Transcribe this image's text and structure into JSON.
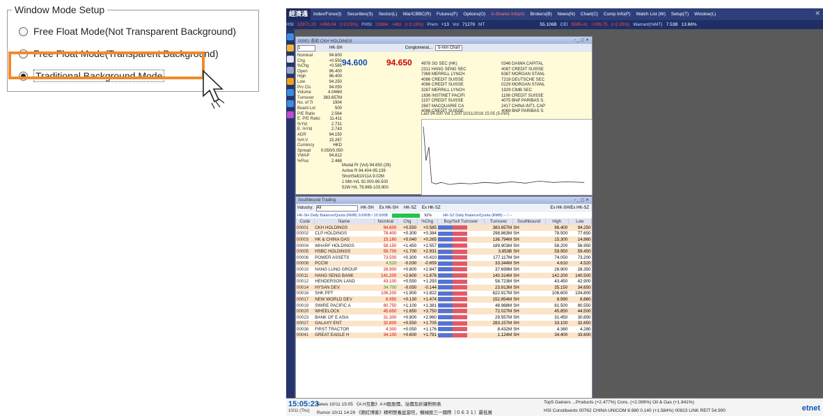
{
  "settings": {
    "legend": "Window Mode Setup",
    "options": [
      {
        "label": "Free Float Mode(Not Transparent Background)",
        "selected": false
      },
      {
        "label": "Free Float Mode(Transparent Background)",
        "selected": false
      },
      {
        "label": "Traditional Background Mode",
        "selected": true
      }
    ],
    "highlight_color": "#f08a2c"
  },
  "app": {
    "logo": "經濟通",
    "menu": [
      "Index/Forex(I)",
      "Securities(S)",
      "Sector(L)",
      "War/CBBC(R)",
      "Futures(F)",
      "Options(O)",
      "A-Shares Info(A)",
      "Brokers(B)",
      "News(N)",
      "Chart(C)",
      "Comp Info(P)",
      "Watch List (W)",
      "Setup(T)",
      "Window(L)"
    ],
    "ticker": {
      "hsi_label": "HSI",
      "hsi_value": "22871.23",
      "hsi_change": "+456.04",
      "hsi_pct": "(+2.03%)",
      "fhsi_label": "FHSI",
      "fhsi_value": "22884",
      "fhsi_change": "+481",
      "fhsi_pct": "(+2.15%)",
      "prem_label": "Prem",
      "prem_value": "+13",
      "vol_label": "Vol",
      "vol_value": "71279",
      "mt_label": "MT",
      "turnover": "55.106B",
      "cei_label": "CEI",
      "cei_value": "9585.41",
      "cei_change": "+206.75",
      "cei_pct": "(+2.20%)",
      "warrant_label": "Warrant(%MT)",
      "warrant_value": "7.53B",
      "warrant_pct": "13.66%"
    },
    "quote": {
      "title": "00001 長和 CKH HOLDINGS",
      "code": "1",
      "tab": "HK-SH",
      "group": "Conglomerat...",
      "period": "5-min Chart",
      "bid": "94.600",
      "ask": "94.650",
      "fields": [
        {
          "k": "Nominal",
          "v": "94.600"
        },
        {
          "k": "Chg",
          "v": "+0.550"
        },
        {
          "k": "%Chg",
          "v": "+0.585"
        },
        {
          "k": "Open",
          "v": "96.400"
        },
        {
          "k": "High",
          "v": "96.400"
        },
        {
          "k": "Low",
          "v": "94.250"
        },
        {
          "k": "Prv Cls",
          "v": "94.050"
        },
        {
          "k": "Volume",
          "v": "4.046M"
        },
        {
          "k": "Turnover",
          "v": "383.657M"
        },
        {
          "k": "No. of Tr",
          "v": "1904"
        },
        {
          "k": "Board Lot",
          "v": "500"
        },
        {
          "k": "P/E Ratio",
          "v": "2.564"
        },
        {
          "k": "E. P/E Ratio",
          "v": "11.411"
        },
        {
          "k": "%Yld",
          "v": "2.731"
        },
        {
          "k": "E. %Yld",
          "v": "2.743"
        },
        {
          "k": "ADR",
          "v": "94.150"
        },
        {
          "k": "%H.V",
          "v": "15.267"
        },
        {
          "k": "Currency",
          "v": "HKD"
        },
        {
          "k": "Spread",
          "v": "0.050/0.050"
        },
        {
          "k": "VWAP",
          "v": "94.812"
        },
        {
          "k": "%Fluc",
          "v": "2.468"
        }
      ],
      "brokers_bid": [
        "4978 SG SEC (HK)",
        "2311 HANG SENG SEC",
        "7369 MERRILL LYNCH",
        "4086 CREDIT SUISSE",
        "4086 CREDIT SUISSE",
        "3287 MERRILL LYNCH",
        "1836 INSTINET PACIFI",
        "1197 CREDIT SUISSE",
        "2847 MACQUARIE CA",
        "4086 CREDIT SUISSE"
      ],
      "brokers_ask": [
        "0346 DAIWA CAPITAL",
        "4087 CREDIT SUISSE",
        "6387 MORGAN STANL",
        "7219 DEUTSCHE SEC",
        "0229 MORGAN STANL",
        "1929 CIMB SEC",
        "1198 CREDIT SUISSE",
        "4075 BNP PARIBAS S.",
        "2417 CHINA INT'L CAP",
        "4069 BNP PARIBAS S."
      ],
      "chart_head": "Last 94.500   Vol 1,500   10/11/2016 15:05 (5-min)",
      "extra": [
        "Modal Pr (Vol)   94.650 (29)",
        "Active R   94.404-95.139",
        "ShortSell10/11A   9.02M",
        "1 Mth H/L   92.000-99.500",
        "52W H/L   79.865-103.900"
      ]
    },
    "southbound": {
      "title": "Southbound Trading",
      "industry_label": "Industry:",
      "industry_value": "All",
      "filters": [
        "HK-SH",
        "Ex HK-SH",
        "HK-SZ",
        "Ex HK-SZ"
      ],
      "export_label": "Ex HK-SH/Ex HK-SZ",
      "quota_sh": "HK-SH Daily Balance/Quota (RMB)  9.690B  / 10.500B",
      "quota_pct": "92%",
      "quota_sz": "HK-SZ Daily Balance/Quota (RMB)  --  /  --",
      "columns": [
        "Code",
        "Name",
        "Nominal",
        "Chg",
        "%Chg",
        "Buy/Sell Turnover",
        "Turnover",
        "Southbound",
        "High",
        "Low"
      ],
      "rows": [
        [
          "00001",
          "CKH HOLDINGS",
          "94.600",
          "+0.550",
          "+0.585",
          "383.657M",
          "SH",
          "96.400",
          "94.250"
        ],
        [
          "00002",
          "CLP HOLDINGS",
          "78.400",
          "+0.300",
          "+0.384",
          "298.863M",
          "SH",
          "78.500",
          "77.650"
        ],
        [
          "00003",
          "HK & CHINA GAS",
          "15.160",
          "+0.040",
          "+0.265",
          "136.794M",
          "SH",
          "15.300",
          "14.860"
        ],
        [
          "00004",
          "WHARF HOLDINGS",
          "58.150",
          "+1.450",
          "+2.557",
          "189.903M",
          "SH",
          "58.200",
          "56.950"
        ],
        [
          "00005",
          "HSBC HOLDINGS",
          "59.700",
          "+1.700",
          "+2.931",
          "3.853B",
          "SH",
          "59.950",
          "59.450"
        ],
        [
          "00006",
          "POWER ASSETS",
          "73.500",
          "+0.300",
          "+0.410",
          "177.117M",
          "SH",
          "74.050",
          "73.200"
        ],
        [
          "00008",
          "PCCW",
          "4.520",
          "-0.030",
          "-0.659",
          "33.344M",
          "SH",
          "4.610",
          "4.520"
        ],
        [
          "00010",
          "HANG LUNG GROUP",
          "28.900",
          "+0.800",
          "+2.847",
          "37.699M",
          "SH",
          "28.900",
          "28.350"
        ],
        [
          "00011",
          "HANG SENG BANK",
          "141.200",
          "+2.600",
          "+1.876",
          "140.314M",
          "SH",
          "142.200",
          "140.500"
        ],
        [
          "00012",
          "HENDERSON LAND",
          "43.100",
          "+0.550",
          "+1.293",
          "58.723M",
          "SH",
          "43.450",
          "42.900"
        ],
        [
          "00014",
          "HYSAN DEV",
          "34.700",
          "-0.050",
          "-0.144",
          "23.913M",
          "SH",
          "35.150",
          "34.650"
        ],
        [
          "00016",
          "SHK PPT",
          "106.200",
          "+1.900",
          "+1.822",
          "622.917M",
          "SH",
          "106.600",
          "104.800"
        ],
        [
          "00017",
          "NEW WORLD DEV",
          "8.950",
          "+0.130",
          "+1.474",
          "152.854M",
          "SH",
          "8.990",
          "8.860"
        ],
        [
          "00019",
          "SWIRE PACIFIC A",
          "80.750",
          "+1.100",
          "+1.381",
          "48.988M",
          "SH",
          "81.500",
          "80.550"
        ],
        [
          "00020",
          "WHEELOCK",
          "45.650",
          "+1.650",
          "+3.750",
          "72.027M",
          "SH",
          "45.850",
          "44.500"
        ],
        [
          "00023",
          "BANK OF E ASIA",
          "31.300",
          "+0.900",
          "+2.960",
          "29.557M",
          "SH",
          "31.450",
          "30.850"
        ],
        [
          "00027",
          "GALAXY ENT",
          "32.800",
          "+0.550",
          "+1.705",
          "283.157M",
          "SH",
          "33.100",
          "32.650"
        ],
        [
          "00038",
          "FIRST TRACTOR",
          "4.300",
          "+0.050",
          "+1.176",
          "8.432M",
          "SH",
          "4.360",
          "4.280"
        ],
        [
          "00041",
          "GREAT EAGLE H",
          "34.100",
          "+0.600",
          "+1.791",
          "1.124M",
          "SH",
          "34.400",
          "33.600"
        ]
      ]
    },
    "news": {
      "time": "15:05:23",
      "date": "10/11 (Thu)",
      "line1": "News  10/11 15:05  《A H互動》A H股股價，溢價及折讓對照表",
      "line2": "Rumor  10/11 14:29  《飽紅博客》精明營養盆當旺，機械股三一國際（０６３１）最低買",
      "right1": "Top5 Gainers   ...Products (+2.477%)   Cons. (+2.099%)   Oil & Gas (+1.841%)",
      "right2": "HSI Constituents   00762  CHINA UNICOM  8.980  0.140  (+1.584%)   00823  LINK REIT  54.900",
      "brand": "etnet"
    }
  }
}
